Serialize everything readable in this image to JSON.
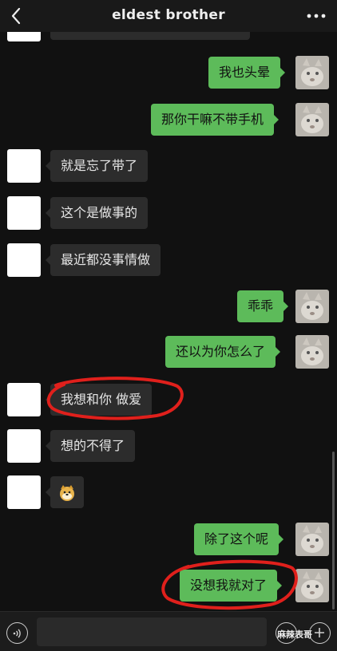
{
  "header": {
    "title": "eldest brother"
  },
  "messages": [
    {
      "side": "left",
      "text": ""
    },
    {
      "side": "right",
      "text": "我也头晕"
    },
    {
      "side": "right",
      "text": "那你干嘛不带手机"
    },
    {
      "side": "left",
      "text": "就是忘了带了"
    },
    {
      "side": "left",
      "text": "这个是做事的"
    },
    {
      "side": "left",
      "text": "最近都没事情做"
    },
    {
      "side": "right",
      "text": "乖乖"
    },
    {
      "side": "right",
      "text": "还以为你怎么了"
    },
    {
      "side": "left",
      "text": "我想和你 做爱"
    },
    {
      "side": "left",
      "text": "想的不得了"
    },
    {
      "side": "left",
      "text": "doge-emoji",
      "emoji": true
    },
    {
      "side": "right",
      "text": "除了这个呢"
    },
    {
      "side": "right",
      "text": "没想我就对了"
    }
  ],
  "footer": {
    "watermark": "麻辣表哥"
  },
  "colors": {
    "sent_bubble": "#5dbb5a",
    "received_bubble": "#2c2c2c",
    "annotation": "#e0201c"
  }
}
